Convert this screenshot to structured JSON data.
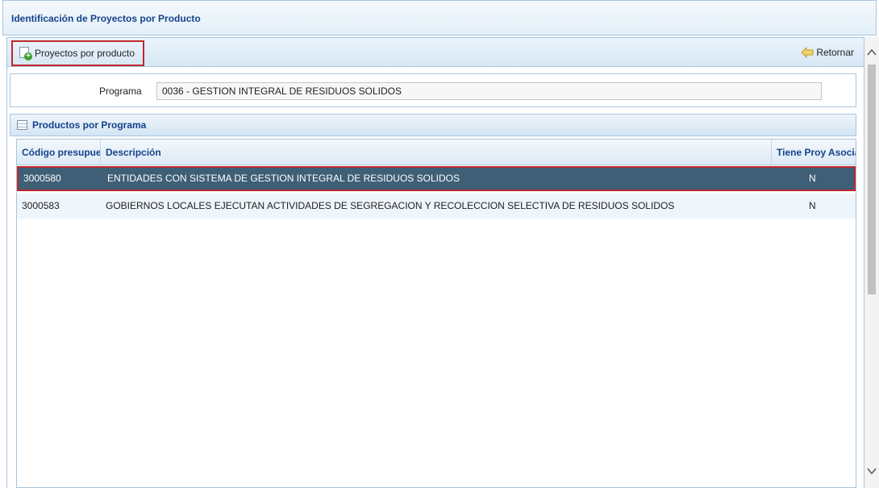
{
  "window": {
    "title": "Identificación de Proyectos por Producto"
  },
  "toolbar": {
    "projects_label": "Proyectos por producto",
    "return_label": "Retornar"
  },
  "programa": {
    "label": "Programa",
    "value": "0036 - GESTION INTEGRAL DE RESIDUOS SOLIDOS"
  },
  "grid": {
    "title": "Productos por Programa",
    "columns": [
      "Código presupuestal",
      "Descripción",
      "Tiene Proy Asociado"
    ],
    "rows": [
      {
        "code": "3000580",
        "description": "ENTIDADES CON SISTEMA DE GESTION INTEGRAL DE RESIDUOS SOLIDOS",
        "has_projects": "N"
      },
      {
        "code": "3000583",
        "description": "GOBIERNOS LOCALES EJECUTAN ACTIVIDADES DE SEGREGACION Y RECOLECCION SELECTIVA DE RESIDUOS SOLIDOS",
        "has_projects": "N"
      }
    ]
  },
  "colors": {
    "selected_row": "#3e5f76",
    "highlight_border": "#c0282b",
    "header_text": "#15428b"
  }
}
